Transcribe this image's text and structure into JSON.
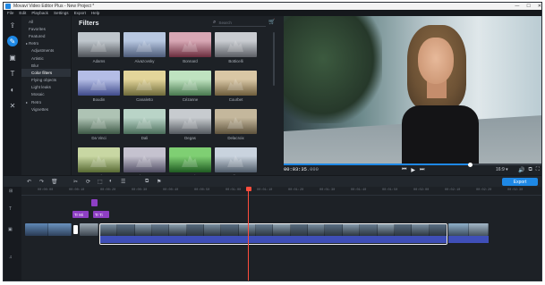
{
  "window": {
    "title": "Movavi Video Editor Plus - New Project *",
    "controls": [
      "—",
      "☐",
      "✕"
    ]
  },
  "menu": [
    "File",
    "Edit",
    "Playback",
    "Settings",
    "Export",
    "Help"
  ],
  "toolstrip": [
    {
      "name": "import-icon",
      "glyph": "⇪"
    },
    {
      "name": "filters-icon",
      "glyph": "✎",
      "active": true
    },
    {
      "name": "transitions-icon",
      "glyph": "▣"
    },
    {
      "name": "titles-icon",
      "glyph": "T"
    },
    {
      "name": "stickers-icon",
      "glyph": "◐"
    },
    {
      "name": "more-tools-icon",
      "glyph": "✕"
    }
  ],
  "categories": [
    {
      "label": "All",
      "sub": false,
      "bullet": false
    },
    {
      "label": "Favorites",
      "sub": false,
      "bullet": false
    },
    {
      "label": "Featured",
      "sub": false,
      "bullet": false
    },
    {
      "label": "Retro",
      "sub": false,
      "bullet": true
    },
    {
      "label": "Adjustments",
      "sub": true,
      "bullet": false
    },
    {
      "label": "Artistic",
      "sub": true,
      "bullet": false
    },
    {
      "label": "Blur",
      "sub": true,
      "bullet": false
    },
    {
      "label": "Color filters",
      "sub": true,
      "bullet": false,
      "active": true
    },
    {
      "label": "Flying objects",
      "sub": true,
      "bullet": false
    },
    {
      "label": "Light leaks",
      "sub": true,
      "bullet": false
    },
    {
      "label": "Mosaic",
      "sub": true,
      "bullet": false
    },
    {
      "label": "Retro",
      "sub": true,
      "bullet": true
    },
    {
      "label": "Vignettes",
      "sub": true,
      "bullet": false
    }
  ],
  "filters": {
    "heading": "Filters",
    "search_placeholder": "Search",
    "items": [
      {
        "label": "Adams",
        "c1": "#bfc6cc",
        "c2": "#4d5157"
      },
      {
        "label": "Aivazovsky",
        "c1": "#b7c7e0",
        "c2": "#4d5b79"
      },
      {
        "label": "Bonnard",
        "c1": "#d7a7b4",
        "c2": "#6b2d3e"
      },
      {
        "label": "Botticelli",
        "c1": "#c9ccd1",
        "c2": "#5b5e64"
      },
      {
        "label": "Boudin",
        "c1": "#b4bde6",
        "c2": "#3f4a8a"
      },
      {
        "label": "Canaletto",
        "c1": "#e3d59a",
        "c2": "#6d6a3a"
      },
      {
        "label": "Cézanne",
        "c1": "#bfe3c0",
        "c2": "#48794f"
      },
      {
        "label": "Courbet",
        "c1": "#d9c7a5",
        "c2": "#6e5d3c"
      },
      {
        "label": "Da Vinci",
        "c1": "#aec3b4",
        "c2": "#3f5a47"
      },
      {
        "label": "Dali",
        "c1": "#b9d4c7",
        "c2": "#4a6d5a"
      },
      {
        "label": "Degas",
        "c1": "#c7cbcf",
        "c2": "#555a60"
      },
      {
        "label": "Delacroix",
        "c1": "#c4b79c",
        "c2": "#5d523c"
      },
      {
        "label": "Doyle",
        "c1": "#c8d7a3",
        "c2": "#586a33"
      },
      {
        "label": "El Greco",
        "c1": "#c5c2cf",
        "c2": "#504d63"
      },
      {
        "label": "Gauguin",
        "c1": "#7fcf73",
        "c2": "#1f5b22"
      },
      {
        "label": "Albert",
        "c1": "#c9d3de",
        "c2": "#4f5b69"
      }
    ]
  },
  "playback": {
    "timecode": "00:03:35",
    "timecode_ms": ".000",
    "progress": 0.72,
    "aspect": "16:9 ▾",
    "buttons": [
      "⏮",
      "▶",
      "⏭"
    ],
    "right_buttons": [
      "🔊",
      "⧉",
      "⛶"
    ]
  },
  "timeline_toolbar": {
    "tools": [
      "↶",
      "↷",
      "🗑",
      "✂",
      "⟳",
      "⬚",
      "◐",
      "☰",
      "⧉",
      "⚑"
    ],
    "export_label": "Export"
  },
  "ruler_ticks": [
    "00:00:00",
    "00:00:10",
    "00:00:20",
    "00:00:30",
    "00:00:40",
    "00:00:50",
    "00:01:00",
    "00:01:10",
    "00:01:20",
    "00:01:30",
    "00:01:40",
    "00:01:50",
    "00:02:00",
    "00:02:10",
    "00:02:20",
    "00:02:30"
  ],
  "title_clips": [
    {
      "label": "Tr Mi"
    },
    {
      "label": "Tr Ti"
    }
  ],
  "colors": {
    "accent": "#1e88e5",
    "title_clip": "#8e3fc4",
    "audio": "#3f4fb8",
    "playhead": "#ff4d3d"
  }
}
